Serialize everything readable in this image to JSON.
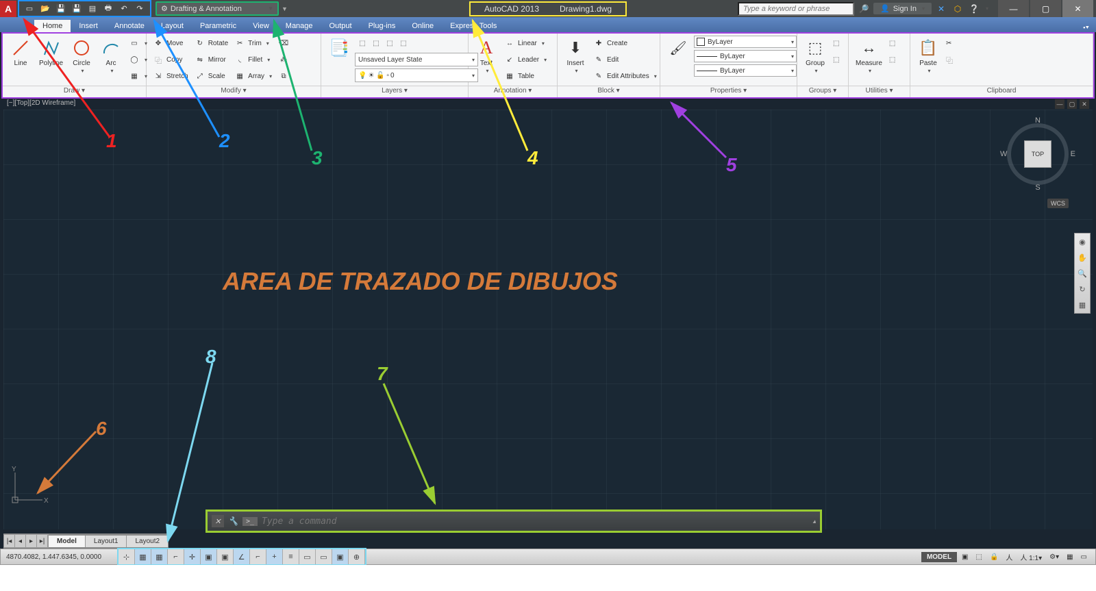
{
  "title": {
    "app": "AutoCAD 2013",
    "file": "Drawing1.dwg"
  },
  "workspace": {
    "label": "Drafting & Annotation"
  },
  "search": {
    "placeholder": "Type a keyword or phrase"
  },
  "signin": {
    "label": "Sign In"
  },
  "tabs": [
    "Home",
    "Insert",
    "Annotate",
    "Layout",
    "Parametric",
    "View",
    "Manage",
    "Output",
    "Plug-ins",
    "Online",
    "Express Tools"
  ],
  "activeTab": "Home",
  "ribbon": {
    "draw": {
      "title": "Draw ▾",
      "line": "Line",
      "polyline": "Polyline",
      "circle": "Circle",
      "arc": "Arc"
    },
    "modify": {
      "title": "Modify ▾",
      "move": "Move",
      "copy": "Copy",
      "stretch": "Stretch",
      "rotate": "Rotate",
      "mirror": "Mirror",
      "scale": "Scale",
      "trim": "Trim",
      "fillet": "Fillet",
      "array": "Array"
    },
    "layers": {
      "title": "Layers ▾",
      "state": "Unsaved Layer State",
      "current": "0"
    },
    "annotation": {
      "title": "Annotation ▾",
      "text": "Text",
      "linear": "Linear",
      "leader": "Leader",
      "table": "Table"
    },
    "block": {
      "title": "Block ▾",
      "insert": "Insert",
      "create": "Create",
      "edit": "Edit",
      "editattr": "Edit Attributes"
    },
    "properties": {
      "title": "Properties ▾",
      "color": "ByLayer",
      "lw": "ByLayer",
      "lt": "ByLayer"
    },
    "groups": {
      "title": "Groups ▾",
      "group": "Group"
    },
    "utilities": {
      "title": "Utilities ▾",
      "measure": "Measure"
    },
    "clipboard": {
      "title": "Clipboard",
      "paste": "Paste"
    }
  },
  "viewport": {
    "label": "[−][Top][2D Wireframe]"
  },
  "nav": {
    "n": "N",
    "s": "S",
    "e": "E",
    "w": "W",
    "top": "TOP",
    "wcs": "WCS"
  },
  "drawing": {
    "label": "AREA DE TRAZADO DE DIBUJOS"
  },
  "cmd": {
    "prompt": ">_",
    "placeholder": "Type a command"
  },
  "layouts": {
    "model": "Model",
    "l1": "Layout1",
    "l2": "Layout2"
  },
  "status": {
    "coords": "4870.4082, 1.447.6345, 0.0000",
    "model": "MODEL"
  },
  "annotations": {
    "n1": "1",
    "n2": "2",
    "n3": "3",
    "n4": "4",
    "n5": "5",
    "n6": "6",
    "n7": "7",
    "n8": "8"
  }
}
